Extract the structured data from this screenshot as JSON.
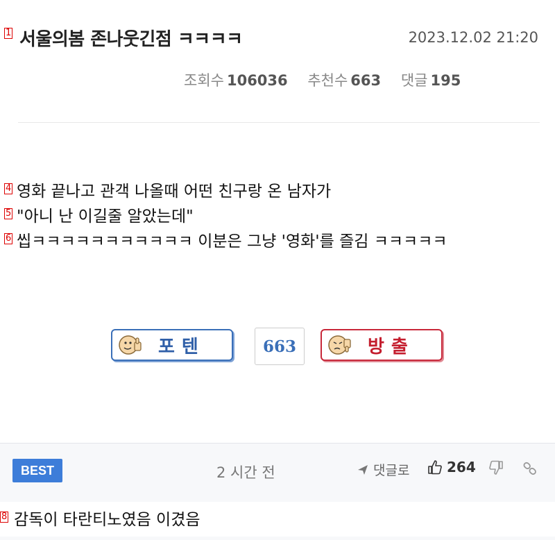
{
  "post": {
    "marker_title": "1",
    "title": "서울의봄 존나웃긴점 ㅋㅋㅋㅋ",
    "datetime": "2023.12.02 21:20",
    "stats": {
      "views_label": "조회수",
      "views": "106036",
      "recommends_label": "추천수",
      "recommends": "663",
      "comments_label": "댓글",
      "comments": "195"
    },
    "lines": [
      {
        "marker": "4",
        "text": "영화 끝나고 관객 나올때 어떤 친구랑 온 남자가"
      },
      {
        "marker": "5",
        "text": "\"아니 난 이길줄 알았는데\""
      },
      {
        "marker": "6",
        "text": "씹ㅋㅋㅋㅋㅋㅋㅋㅋㅋㅋㅋ 이분은 그냥 '영화'를 즐김 ㅋㅋㅋㅋㅋ"
      }
    ]
  },
  "vote": {
    "up_label": "포텐",
    "count": "663",
    "down_label": "방출",
    "up_color": "#3a6fb8",
    "down_color": "#c8283a",
    "up_icon": "thumbs-up-face-icon",
    "down_icon": "thumbs-down-face-icon"
  },
  "comment": {
    "badge": "BEST",
    "time": "2 시간 전",
    "reply_label": "댓글로",
    "likes": "264",
    "marker": "8",
    "text": "감독이 타란티노였음 이겼음",
    "badge_color": "#3d7dd9",
    "icons": {
      "reply": "arrow-icon",
      "like": "thumbs-up-icon",
      "dislike": "thumbs-down-icon",
      "link": "link-icon"
    }
  }
}
